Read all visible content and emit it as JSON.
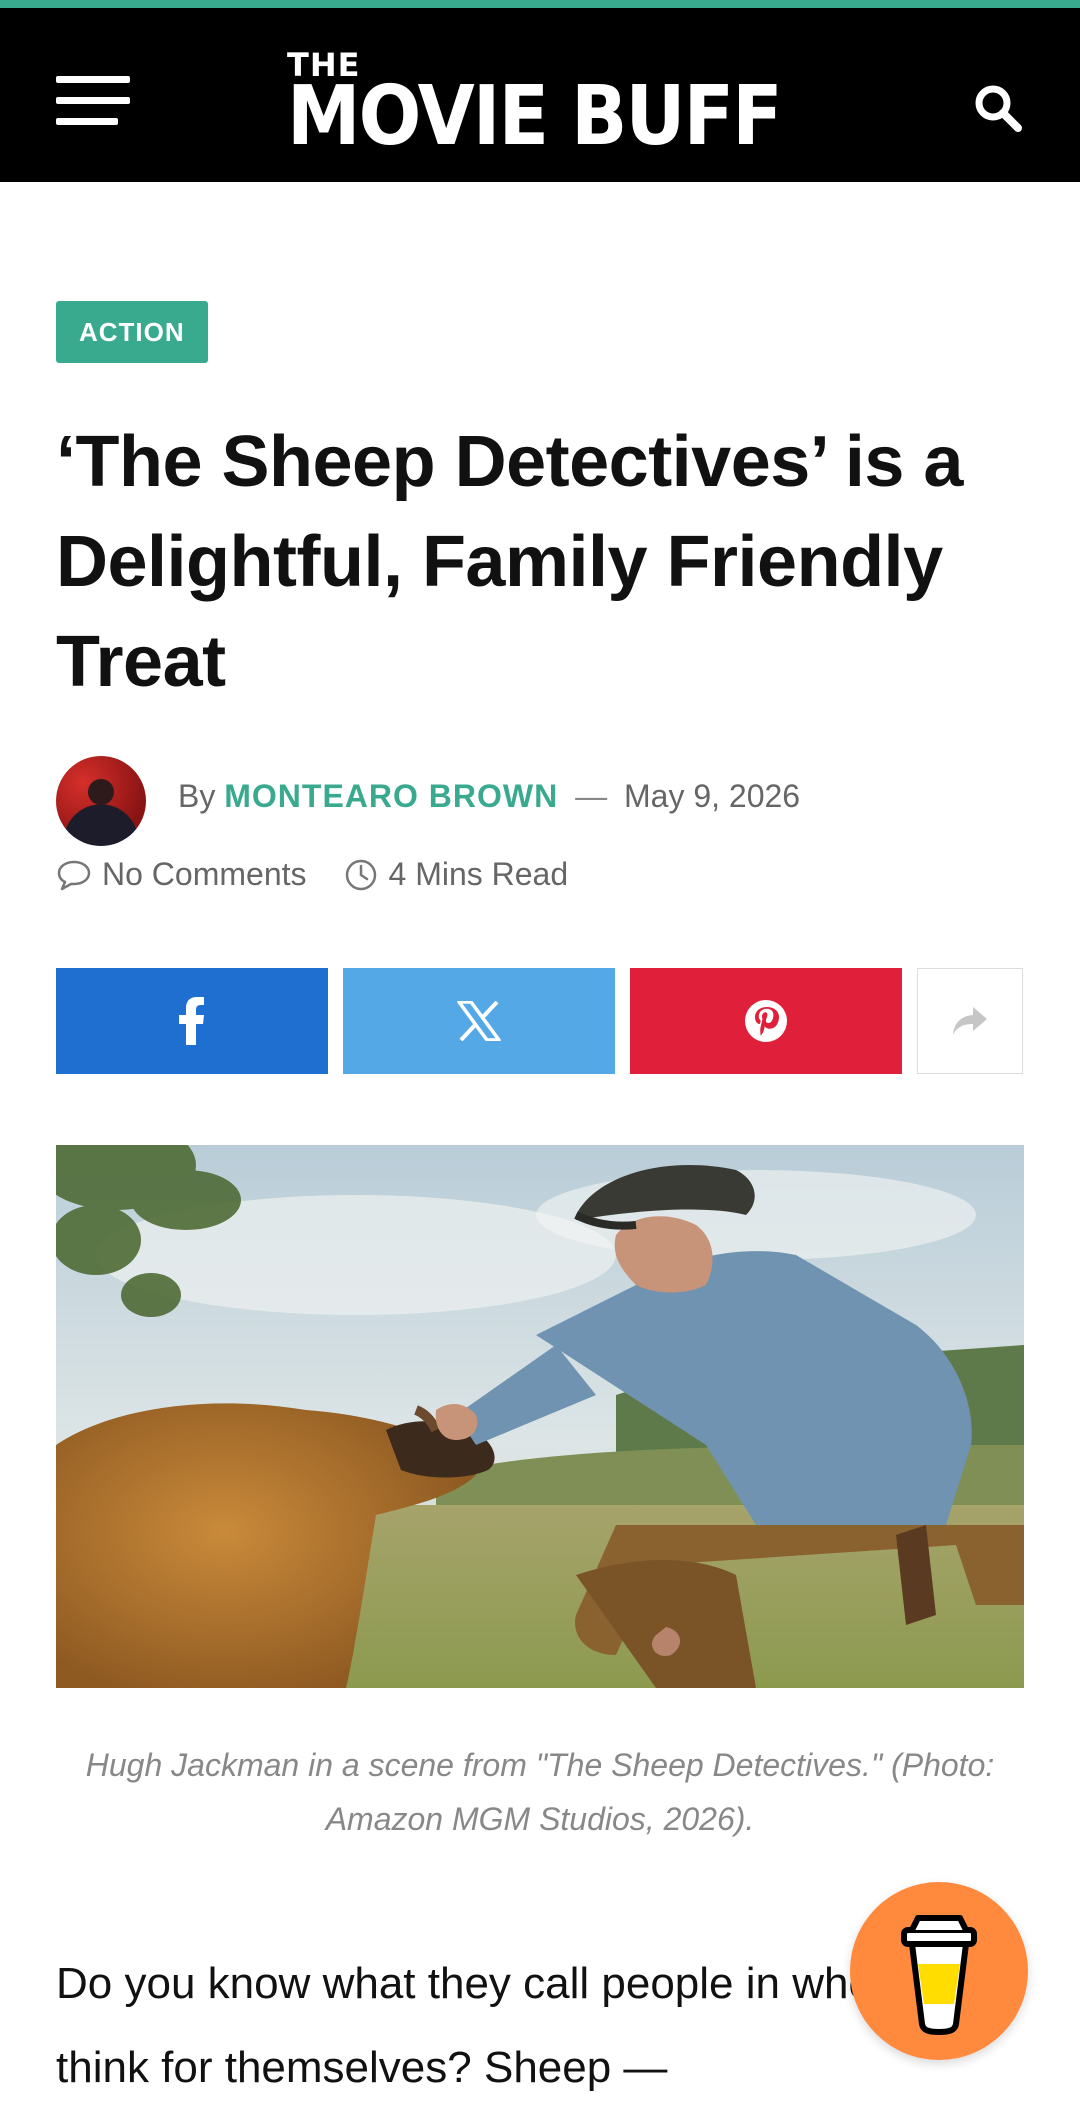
{
  "header": {
    "logo_small": "THE",
    "logo_main": "MOVIE BUFF",
    "menu_icon": "hamburger-menu-icon",
    "search_icon": "search-icon",
    "background": "#000000",
    "accent": "#3aaa8f"
  },
  "article": {
    "category": "ACTION",
    "title": "‘The Sheep Detectives’ is a Delightful, Family Friendly Treat",
    "by_prefix": "By",
    "author": "MONTEARO BROWN",
    "dash": "—",
    "date": "May 9, 2026",
    "comments": "No Comments",
    "read_time": "4 Mins Read",
    "caption": "Hugh Jackman in a scene from \"The Sheep Detectives.\" (Photo: Amazon MGM Studios, 2026).",
    "body_intro": "Do you know what they call people in who can’t think for themselves? Sheep —"
  },
  "share": {
    "facebook_color": "#1e6fd0",
    "x_color": "#55a8e6",
    "pinterest_color": "#e0203a",
    "icons": [
      "facebook-icon",
      "x-icon",
      "pinterest-icon",
      "share-arrow-icon"
    ]
  },
  "floating": {
    "icon": "coffee-cup-icon",
    "color": "#ff8a3d"
  }
}
